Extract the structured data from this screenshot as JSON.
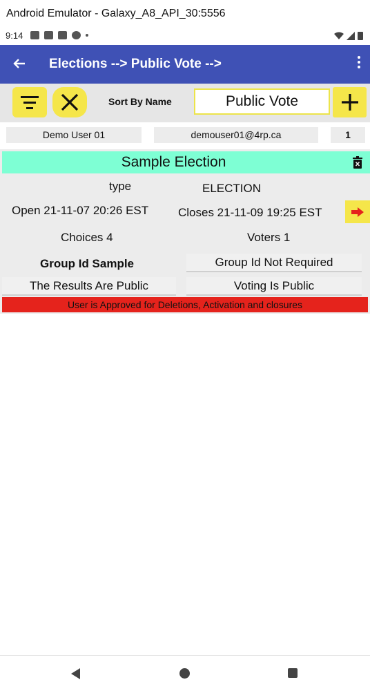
{
  "window": {
    "title": "Android Emulator - Galaxy_A8_API_30:5556"
  },
  "status_bar": {
    "time": "9:14"
  },
  "app_bar": {
    "back_icon": "arrow-back-icon",
    "title": "Elections --> Public Vote -->",
    "menu_icon": "more-vert-icon"
  },
  "toolbar": {
    "filter_icon": "filter-list-icon",
    "clear_icon": "close-icon",
    "sort_label": "Sort By Name",
    "filter_value": "Public Vote",
    "add_icon": "plus-icon"
  },
  "user": {
    "name": "Demo  User 01",
    "email": "demouser01@4rp.ca",
    "count": "1"
  },
  "election": {
    "title": "Sample Election",
    "type_label": "type",
    "type_value": "ELECTION",
    "open": "Open  21-11-07 20:26 EST",
    "closes": "Closes  21-11-09 19:25 EST",
    "choices": "Choices  4",
    "voters": "Voters 1",
    "group_id": "Group Id  Sample",
    "group_required": "Group Id Not Required",
    "results": "The Results Are Public",
    "voting": "Voting Is Public",
    "approval": "User is Approved for Deletions, Activation and closures"
  },
  "colors": {
    "app_bar": "#3f51b5",
    "accent_yellow": "#f5e64a",
    "title_mint": "#7effd4",
    "approval_red": "#e5231c"
  }
}
